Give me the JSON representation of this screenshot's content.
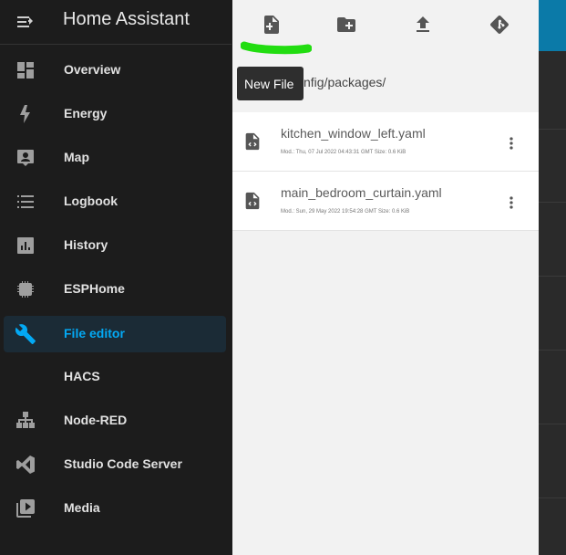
{
  "sidebar": {
    "title": "Home Assistant",
    "items": [
      {
        "label": "Overview",
        "icon": "dashboard-icon"
      },
      {
        "label": "Energy",
        "icon": "lightning-bolt-icon"
      },
      {
        "label": "Map",
        "icon": "account-box-icon"
      },
      {
        "label": "Logbook",
        "icon": "list-icon"
      },
      {
        "label": "History",
        "icon": "chart-box-icon"
      },
      {
        "label": "ESPHome",
        "icon": "chip-icon"
      },
      {
        "label": "File editor",
        "icon": "wrench-icon",
        "active": true
      },
      {
        "label": "HACS",
        "icon": "blank"
      },
      {
        "label": "Node-RED",
        "icon": "sitemap-icon"
      },
      {
        "label": "Studio Code Server",
        "icon": "vscode-icon"
      },
      {
        "label": "Media",
        "icon": "play-box-icon"
      }
    ]
  },
  "toolbar": {
    "buttons": [
      "new-file-icon",
      "new-folder-icon",
      "upload-icon",
      "git-icon"
    ],
    "tooltip": "New File"
  },
  "browser": {
    "path": "nfig/packages/"
  },
  "files": [
    {
      "name": "kitchen_window_left.yaml",
      "meta": "Mod.: Thu, 07 Jul 2022 04:43:31 GMT  Size: 0.6 KiB"
    },
    {
      "name": "main_bedroom_curtain.yaml",
      "meta": "Mod.: Sun, 29 May 2022 19:54:28 GMT  Size: 0.6 KiB"
    }
  ],
  "colors": {
    "accent": "#03a9f4",
    "highlight_annotation": "#22dd11",
    "sidebar_bg": "#1c1c1c"
  }
}
